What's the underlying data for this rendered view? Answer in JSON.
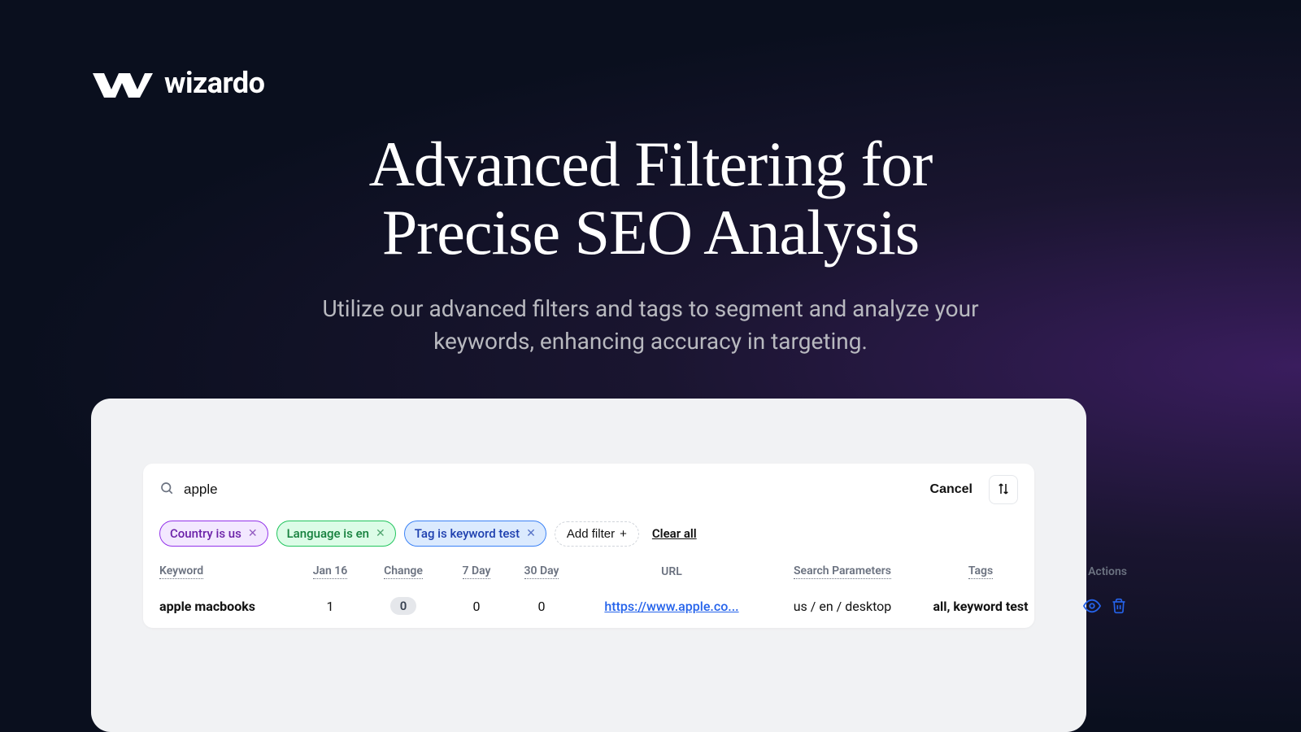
{
  "brand": {
    "name": "wizardo"
  },
  "hero": {
    "title_line1": "Advanced Filtering for",
    "title_line2": "Precise SEO Analysis",
    "subtitle_line1": "Utilize our advanced filters and tags to segment and analyze your",
    "subtitle_line2": "keywords, enhancing accuracy in targeting."
  },
  "search": {
    "value": "apple",
    "cancel_label": "Cancel"
  },
  "filters": {
    "chips": [
      {
        "label": "Country is us",
        "color": "purple"
      },
      {
        "label": "Language is en",
        "color": "green"
      },
      {
        "label": "Tag is keyword test",
        "color": "blue"
      }
    ],
    "add_label": "Add filter",
    "clear_label": "Clear all"
  },
  "table": {
    "headers": {
      "keyword": "Keyword",
      "date": "Jan 16",
      "change": "Change",
      "d7": "7 Day",
      "d30": "30 Day",
      "url": "URL",
      "params": "Search Parameters",
      "tags": "Tags",
      "actions": "Actions"
    },
    "rows": [
      {
        "keyword": "apple macbooks",
        "date": "1",
        "change": "0",
        "d7": "0",
        "d30": "0",
        "url": "https://www.apple.co...",
        "params": "us / en / desktop",
        "tags": "all, keyword test"
      }
    ]
  }
}
